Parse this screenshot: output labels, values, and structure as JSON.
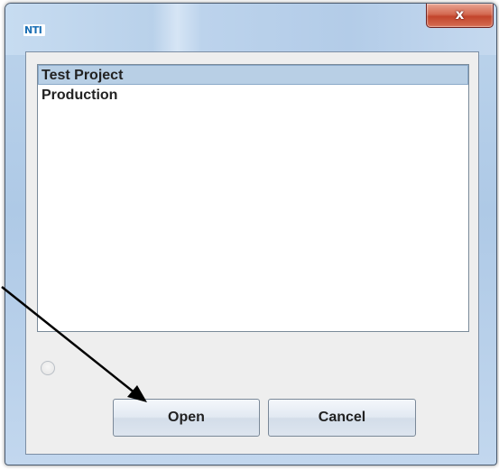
{
  "window": {
    "app_icon_text": "NTI",
    "close_label": "x"
  },
  "project_list": {
    "items": [
      {
        "label": "Test Project",
        "selected": true
      },
      {
        "label": "Production",
        "selected": false
      }
    ]
  },
  "buttons": {
    "open_label": "Open",
    "cancel_label": "Cancel"
  },
  "colors": {
    "selection": "#b8cfe5",
    "close_button": "#c2452c",
    "annotation_arrow": "#000000"
  }
}
